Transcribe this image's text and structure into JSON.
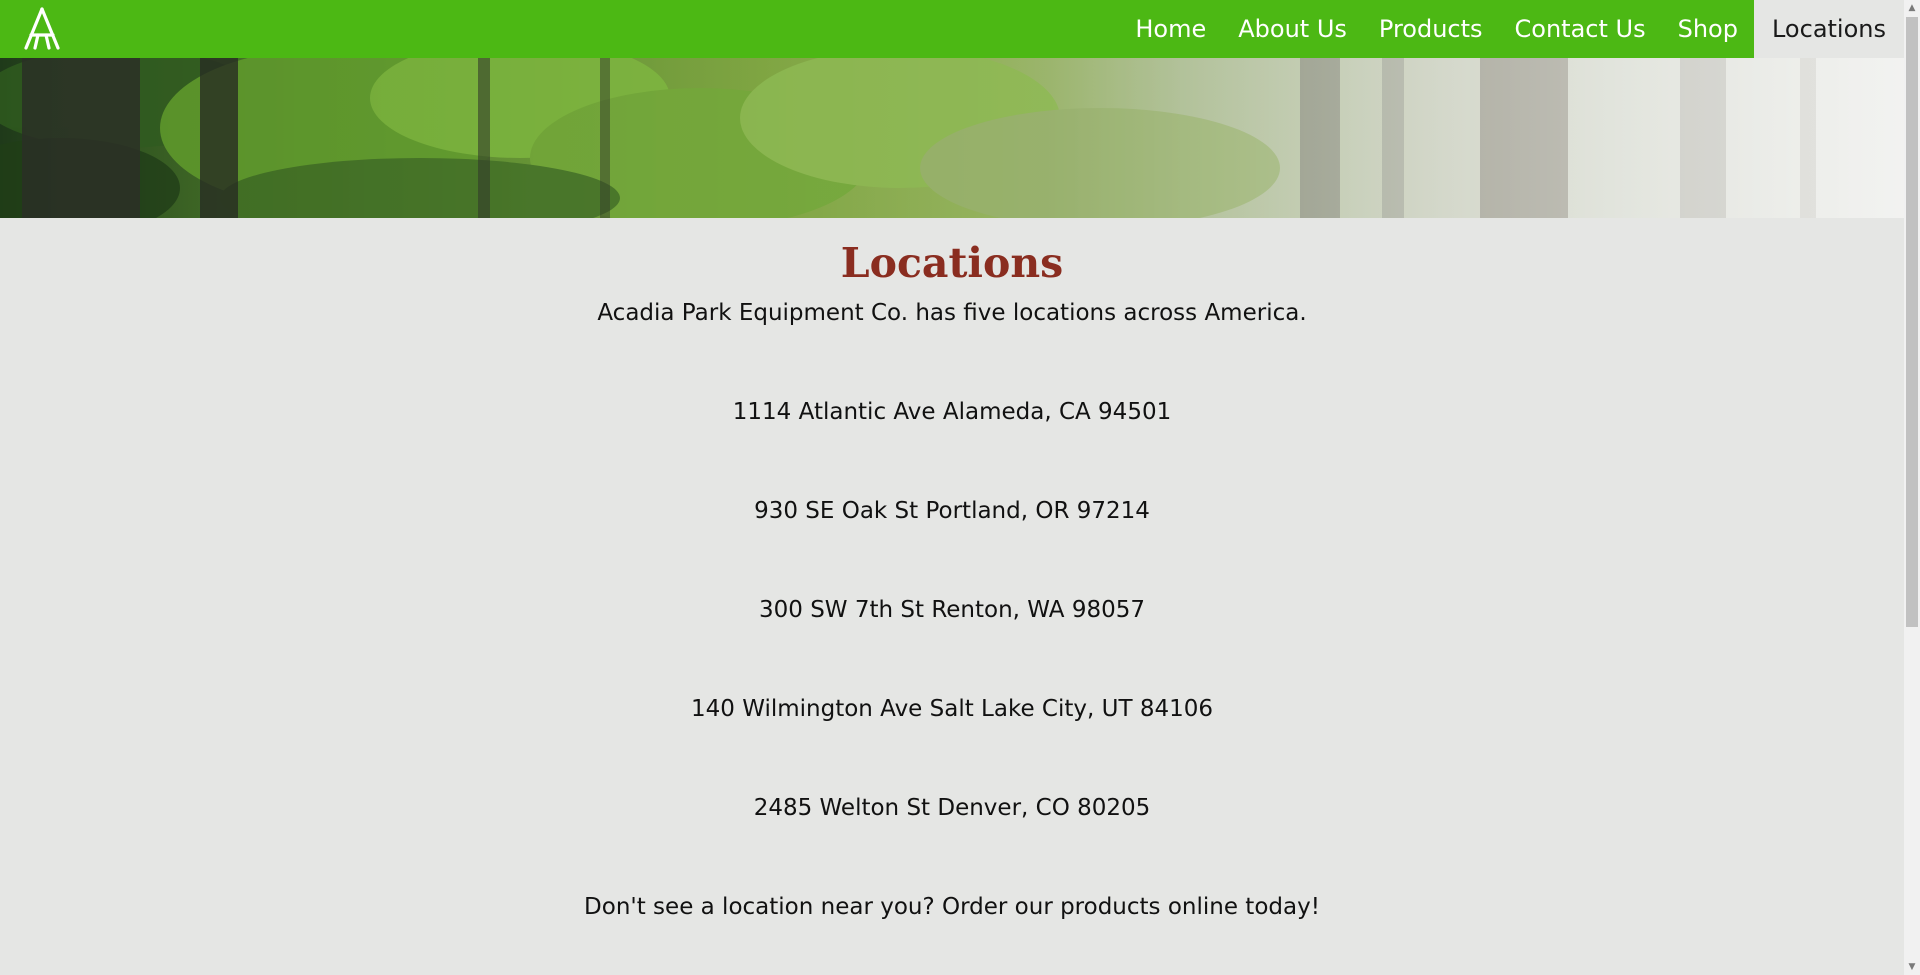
{
  "nav": {
    "logo_icon": "acadia-logo-icon",
    "items": [
      {
        "label": "Home"
      },
      {
        "label": "About Us"
      },
      {
        "label": "Products"
      },
      {
        "label": "Contact Us"
      },
      {
        "label": "Shop"
      },
      {
        "label": "Locations",
        "active": true
      }
    ],
    "brand_color": "#4cb814"
  },
  "hero": {
    "image": "forest-banner"
  },
  "main": {
    "title": "Locations",
    "title_color": "#8a2d20",
    "intro": "Acadia Park Equipment Co. has five locations across America.",
    "addresses": [
      "1114 Atlantic Ave Alameda, CA 94501",
      "930 SE Oak St Portland, OR 97214",
      "300 SW 7th St Renton, WA 98057",
      "140 Wilmington Ave Salt Lake City, UT 84106",
      "2485 Welton St Denver, CO 80205"
    ],
    "closing": "Don't see a location near you? Order our products online today!"
  }
}
